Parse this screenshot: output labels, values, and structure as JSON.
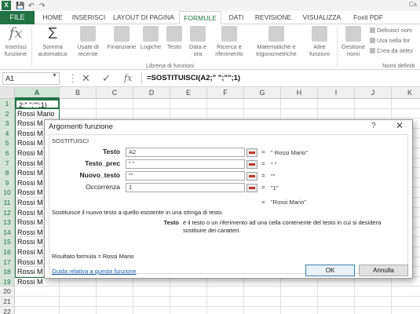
{
  "titlebar": {
    "logo": "X",
    "quick_access": [
      "💾",
      "↶",
      "↷"
    ],
    "right_text": "Ca"
  },
  "tabs": {
    "file": "FILE",
    "items": [
      "HOME",
      "INSERISCI",
      "LAYOUT DI PAGINA",
      "FORMULE",
      "DATI",
      "REVISIONE",
      "VISUALIZZA",
      "Foxit PDF"
    ],
    "active": "FORMULE"
  },
  "ribbon": {
    "insert_function": [
      "Inserisci",
      "funzione"
    ],
    "autosum": [
      "Somma",
      "automatica"
    ],
    "recent": [
      "Usate di",
      "recente"
    ],
    "financial": [
      "Finanziarie",
      ""
    ],
    "logical": [
      "Logiche",
      ""
    ],
    "text": [
      "Testo",
      ""
    ],
    "datetime": [
      "Data e",
      "ora"
    ],
    "lookup": [
      "Ricerca e",
      "riferimento"
    ],
    "math": [
      "Matematiche e",
      "trigonometriche"
    ],
    "more": [
      "Altre",
      "funzioni"
    ],
    "name_manager": [
      "Gestione",
      "nomi"
    ],
    "group_library": "Libreria di funzioni",
    "names": [
      "Definisci nom",
      "Usa nella for",
      "Crea da selez"
    ],
    "group_names": "Nomi definiti"
  },
  "formula_bar": {
    "name_box": "A1",
    "formula": "=SOSTITUISCI(A2;\" \";\"\";1)"
  },
  "grid": {
    "columns": [
      "A",
      "B",
      "C",
      "D",
      "E",
      "F",
      "G",
      "H",
      "I",
      "J",
      "K"
    ],
    "selected_column": "A",
    "rows": [
      "1",
      "2",
      "3",
      "4",
      "5",
      "6",
      "7",
      "8",
      "9",
      "10",
      "11",
      "12",
      "13",
      "14",
      "15",
      "16",
      "17",
      "18",
      "19",
      "20",
      "21",
      "22"
    ],
    "col_a_values": [
      "2;\" \";\"\";1)",
      "Rossi Mario",
      "Rossi M",
      "Rossi M",
      "Rossi M",
      "Rossi M",
      "Rossi M",
      "Rossi M",
      "Rossi M",
      "Rossi M",
      "Rossi M",
      "Rossi M",
      "Rossi M",
      "Rossi M",
      "Rossi M",
      "Rossi M",
      "Rossi M",
      "Rossi M",
      "Rossi M",
      "",
      "",
      ""
    ]
  },
  "dialog": {
    "title": "Argomenti funzione",
    "help": "?",
    "close": "✕",
    "function_name": "SOSTITUISCI",
    "args": [
      {
        "label": "Testo",
        "value": "A2",
        "result": "\" Rossi Mario\"",
        "bold": true
      },
      {
        "label": "Testo_prec",
        "value": "\" \"",
        "result": "\" \"",
        "bold": true
      },
      {
        "label": "Nuovo_testo",
        "value": "\"\"",
        "result": "\"\"",
        "bold": true
      },
      {
        "label": "Occorrenza",
        "value": "1",
        "result": "\"1\"",
        "bold": false
      }
    ],
    "function_result": "\"Rossi Mario\"",
    "description": "Sostituisce il nuovo testo a quello esistente in una stringa di testo.",
    "arg_desc_name": "Testo",
    "arg_desc": "è il testo o un riferimento ad una cella contenente del testo in cui si desidera sostituire dei caratteri.",
    "formula_result": "Risultato formula =    Rossi Mario",
    "help_link": "Guida relativa a questa funzione",
    "ok": "OK",
    "cancel": "Annulla"
  },
  "colors": {
    "accent": "#217346",
    "link": "#1a5fb4",
    "selected_header": "#d3e5d7"
  }
}
